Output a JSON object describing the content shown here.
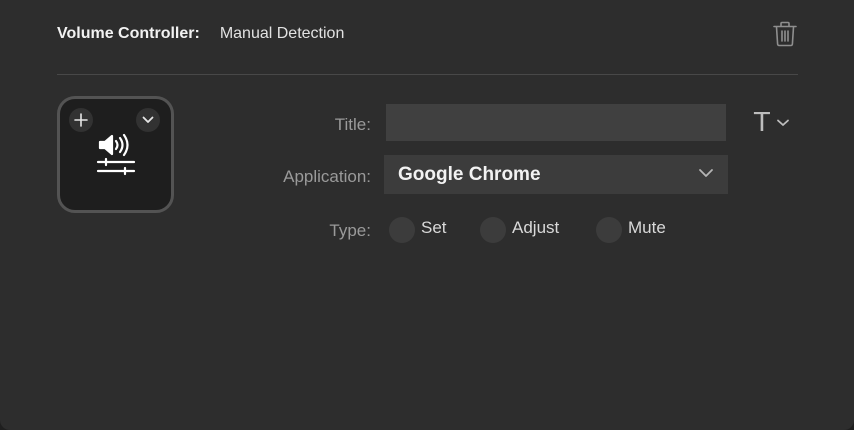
{
  "header": {
    "label": "Volume Controller:",
    "value": "Manual Detection"
  },
  "icons": {
    "delete": "trash-icon",
    "add": "plus-icon",
    "menu": "chevron-down-icon",
    "key": "volume-slider-icon",
    "font": "text-format-icon",
    "select": "chevron-down-icon"
  },
  "form": {
    "title_label": "Title:",
    "title_value": "",
    "application_label": "Application:",
    "application_value": "Google Chrome",
    "type_label": "Type:",
    "type_options": [
      {
        "label": "Set",
        "selected": false
      },
      {
        "label": "Adjust",
        "selected": false
      },
      {
        "label": "Mute",
        "selected": false
      }
    ]
  },
  "font_button": {
    "glyph": "T"
  },
  "colors": {
    "panel": "#2d2d2d",
    "input": "#404040",
    "key_background": "#1e1e1e",
    "label_text": "#9a9a9a"
  }
}
